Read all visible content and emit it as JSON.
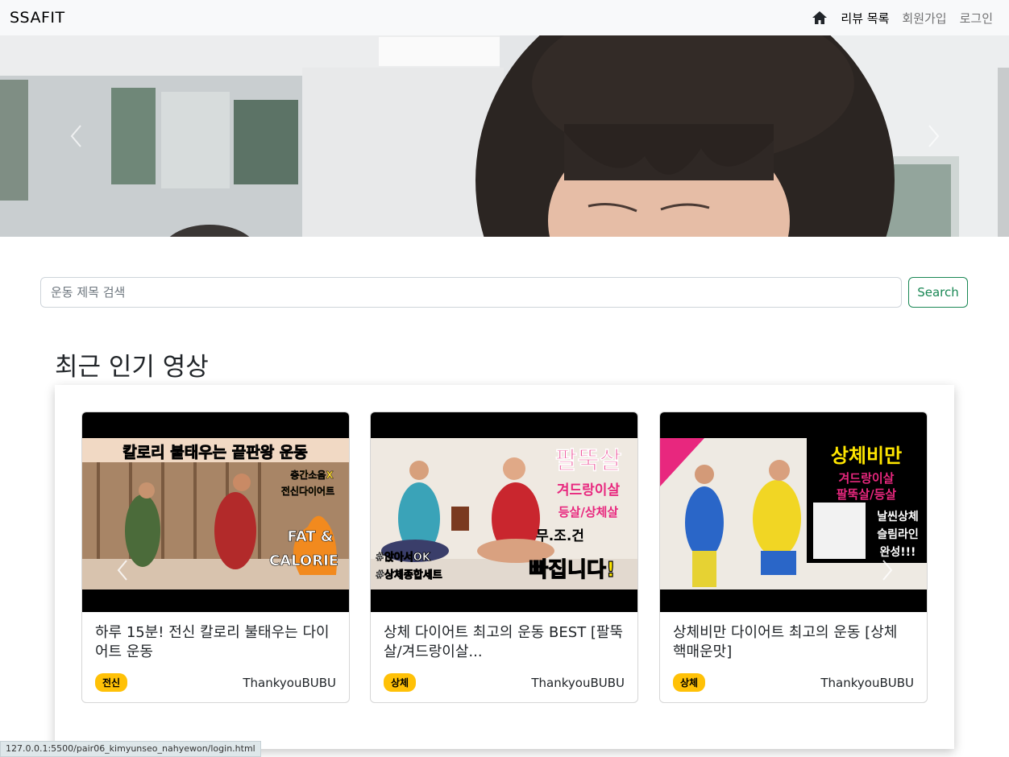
{
  "navbar": {
    "brand": "SSAFIT",
    "links": [
      {
        "label": "리뷰 목록"
      },
      {
        "label": "회원가입"
      },
      {
        "label": "로그인"
      }
    ]
  },
  "search": {
    "placeholder": "운동 제목 검색",
    "button_label": "Search"
  },
  "section": {
    "title": "최근 인기 영상"
  },
  "videos": [
    {
      "title": "하루 15분! 전신 칼로리 불태우는 다이어트 운동",
      "tag": "전신",
      "channel": "ThankyouBUBU",
      "thumb_text": [
        "칼로리 불태우는 끝판왕 운동",
        "층간소음X",
        "전신다이어트",
        "FAT &",
        "CALORIE"
      ]
    },
    {
      "title": "상체 다이어트 최고의 운동 BEST [팔뚝살/겨드랑이살...",
      "tag": "상체",
      "channel": "ThankyouBUBU",
      "thumb_text": [
        "팔뚝살",
        "겨드랑이살",
        "등살/상체살",
        "무.조.건",
        "빠집니다!",
        "#앉아서OK",
        "#상체종합세트"
      ]
    },
    {
      "title": "상체비만 다이어트 최고의 운동 [상체 핵매운맛]",
      "tag": "상체",
      "channel": "ThankyouBUBU",
      "thumb_text": [
        "상체비만",
        "겨드랑이살",
        "팔뚝살/등살",
        "날씬상체",
        "슬림라인",
        "완성!!!"
      ]
    }
  ],
  "status_bar": {
    "url": "127.0.0.1:5500/pair06_kimyunseo_nahyewon/login.html"
  }
}
